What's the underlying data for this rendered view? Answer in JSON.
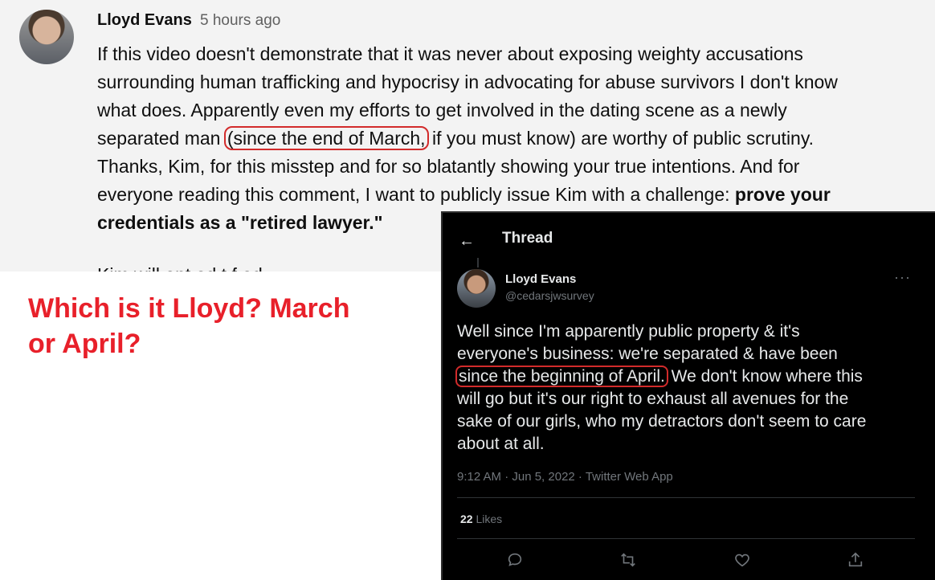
{
  "comment": {
    "author": "Lloyd Evans",
    "time": "5 hours ago",
    "lines": {
      "l1": "If this video doesn't demonstrate that it was never about exposing weighty accusations",
      "l2": "surrounding human trafficking and hypocrisy in advocating for abuse survivors I don't know",
      "l3": "what does. Apparently even my efforts to get involved in the dating scene as a newly",
      "l4_pre": "separated man ",
      "l4_hl": "(since the end of March,",
      "l4_post": " if you must know) are worthy of public scrutiny.",
      "l5": "Thanks, Kim, for this misstep and for so blatantly showing your true intentions. And for",
      "l6_pre": "everyone reading this comment, I want to publicly issue Kim with a challenge: ",
      "l6_bold": "prove your",
      "l7_bold": "credentials as a \"retired lawyer.\"",
      "cut": "Kim will    ent    ad t  f  ad"
    }
  },
  "caption": {
    "line1": "Which is it Lloyd?  March",
    "line2": "or April?"
  },
  "tweet": {
    "header_title": "Thread",
    "name": "Lloyd Evans",
    "handle": "@cedarsjwsurvey",
    "more": "···",
    "lines": {
      "l1": "Well since I'm apparently public property & it's",
      "l2": "everyone's business: we're separated & have been",
      "l3_hl": "since the beginning of April.",
      "l3_post": " We don't know where this",
      "l4": "will go but it's our right to exhaust all avenues for the",
      "l5": "sake of our girls, who my detractors don't seem to care",
      "l6": "about at all."
    },
    "meta": "9:12 AM · Jun 5, 2022 · Twitter Web App",
    "likes_count": "22",
    "likes_label": "Likes",
    "icons": [
      "back-arrow-icon",
      "reply-icon",
      "retweet-icon",
      "like-icon",
      "share-icon"
    ]
  },
  "colors": {
    "highlight_red": "#d22b2b",
    "caption_red": "#e8202a",
    "tweet_bg": "#000000",
    "comment_bg": "#f3f3f3"
  }
}
